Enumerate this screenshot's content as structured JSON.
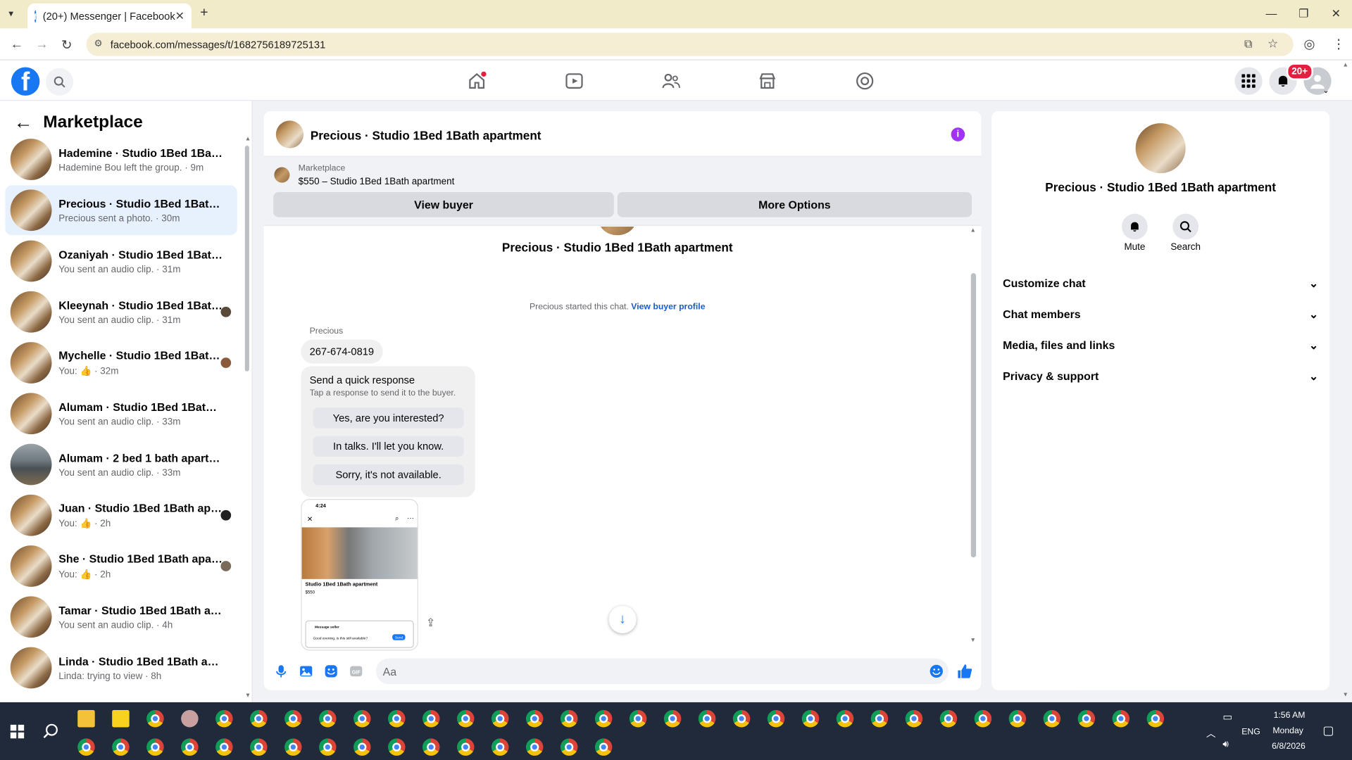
{
  "browser": {
    "tab_title": "(20+) Messenger | Facebook",
    "url": "facebook.com/messages/t/1682756189725131"
  },
  "fb": {
    "notif_badge": "20+"
  },
  "sidebar": {
    "title": "Marketplace",
    "items": [
      {
        "name": "Hademine · Studio 1Bed 1Bath a...",
        "sub": "Hademine Bou left the group. · 9m"
      },
      {
        "name": "Precious · Studio 1Bed 1Bath apa...",
        "sub": "Precious sent a photo. · 30m"
      },
      {
        "name": "Ozaniyah · Studio 1Bed 1Bath ap...",
        "sub": "You sent an audio clip. · 31m"
      },
      {
        "name": "Kleeynah · Studio 1Bed 1Bath ...",
        "sub": "You sent an audio clip. · 31m"
      },
      {
        "name": "Mychelle · Studio 1Bed 1Bath ...",
        "sub": "You: 👍 · 32m"
      },
      {
        "name": "Alumam · Studio 1Bed 1Bath apa...",
        "sub": "You sent an audio clip. · 33m"
      },
      {
        "name": "Alumam · 2 bed 1 bath apartment",
        "sub": "You sent an audio clip. · 33m"
      },
      {
        "name": "Juan · Studio 1Bed 1Bath apart...",
        "sub": "You: 👍 · 2h"
      },
      {
        "name": "She · Studio 1Bed 1Bath apart...",
        "sub": "You: 👍 · 2h"
      },
      {
        "name": "Tamar · Studio 1Bed 1Bath apart...",
        "sub": "You sent an audio clip. · 4h"
      },
      {
        "name": "Linda · Studio 1Bed 1Bath apart...",
        "sub": "Linda: trying to view · 8h"
      }
    ]
  },
  "chat": {
    "title": "Precious · Studio 1Bed 1Bath apartment",
    "marketplace_label": "Marketplace",
    "listing": "$550 – Studio 1Bed 1Bath apartment",
    "view_buyer": "View buyer",
    "more_options": "More Options",
    "thread_title": "Precious · Studio 1Bed 1Bath apartment",
    "started_text": "Precious started this chat.",
    "view_buyer_profile": "View buyer profile",
    "sender": "Precious",
    "phone": "267-674-0819",
    "quick_title": "Send a quick response",
    "quick_sub": "Tap a response to send it to the buyer.",
    "quick_options": [
      "Yes, are you interested?",
      "In talks. I'll let you know.",
      "Sorry, it's not available."
    ],
    "photo_time": "4:24",
    "photo_listing": "Studio 1Bed 1Bath apartment",
    "photo_price": "$550",
    "photo_msg_label": "Message seller",
    "photo_msg": "Good evening, is this still available?",
    "photo_send": "Send",
    "composer_placeholder": "Aa"
  },
  "details": {
    "name": "Precious · Studio 1Bed 1Bath apartment",
    "mute": "Mute",
    "search": "Search",
    "sections": [
      "Customize chat",
      "Chat members",
      "Media, files and links",
      "Privacy & support"
    ]
  },
  "taskbar": {
    "time": "1:56 AM",
    "day": "Monday",
    "date": "6/8/2026",
    "lang": "ENG"
  },
  "colors": {
    "brand": "#1877f2",
    "badge": "#e41e3f",
    "info": "#a033f5"
  }
}
